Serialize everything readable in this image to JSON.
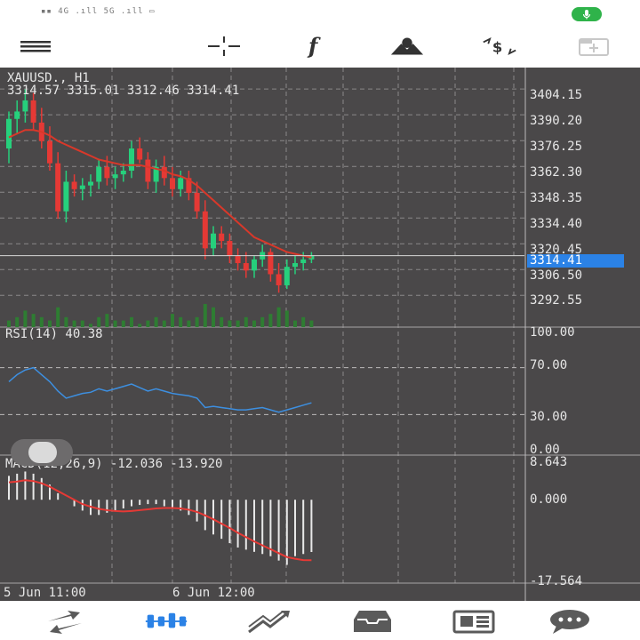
{
  "status_bar": {
    "signal_text": "▪▪ 4G .ıll 5G .ıll ▭"
  },
  "toolbar": {
    "icons": [
      "menu-icon",
      "crosshair-icon",
      "indicators-icon",
      "objects-icon",
      "trade-icon",
      "new-window-icon"
    ]
  },
  "chart": {
    "symbol_line": "XAUUSD., H1",
    "ohlc_line": "3314.57 3315.01 3312.46 3314.41",
    "current_price": "3314.41",
    "price_axis": [
      "3404.15",
      "3390.20",
      "3376.25",
      "3362.30",
      "3348.35",
      "3334.40",
      "3320.45",
      "3306.50",
      "3292.55"
    ],
    "time_axis": [
      "5 Jun 11:00",
      "6 Jun 12:00"
    ],
    "rsi": {
      "label": "RSI(14) 40.38",
      "levels": [
        "100.00",
        "70.00",
        "30.00",
        "0.00"
      ]
    },
    "macd": {
      "label": "MACD(12,26,9) -12.036 -13.920",
      "levels": [
        "8.643",
        "0.000",
        "-17.564"
      ]
    }
  },
  "chart_data": {
    "type": "line",
    "title": "XAUUSD., H1",
    "xlabel": "",
    "ylabel": "",
    "price_ylim": [
      3285,
      3410
    ],
    "candles": [
      {
        "o": 3372,
        "h": 3392,
        "l": 3364,
        "c": 3388
      },
      {
        "o": 3388,
        "h": 3398,
        "l": 3380,
        "c": 3392
      },
      {
        "o": 3392,
        "h": 3404,
        "l": 3386,
        "c": 3398
      },
      {
        "o": 3398,
        "h": 3402,
        "l": 3382,
        "c": 3386
      },
      {
        "o": 3386,
        "h": 3394,
        "l": 3372,
        "c": 3376
      },
      {
        "o": 3376,
        "h": 3384,
        "l": 3360,
        "c": 3364
      },
      {
        "o": 3364,
        "h": 3370,
        "l": 3334,
        "c": 3338
      },
      {
        "o": 3338,
        "h": 3360,
        "l": 3332,
        "c": 3354
      },
      {
        "o": 3354,
        "h": 3358,
        "l": 3346,
        "c": 3350
      },
      {
        "o": 3350,
        "h": 3356,
        "l": 3344,
        "c": 3352
      },
      {
        "o": 3352,
        "h": 3358,
        "l": 3346,
        "c": 3354
      },
      {
        "o": 3354,
        "h": 3366,
        "l": 3350,
        "c": 3362
      },
      {
        "o": 3362,
        "h": 3368,
        "l": 3352,
        "c": 3356
      },
      {
        "o": 3356,
        "h": 3362,
        "l": 3350,
        "c": 3358
      },
      {
        "o": 3358,
        "h": 3364,
        "l": 3354,
        "c": 3360
      },
      {
        "o": 3360,
        "h": 3376,
        "l": 3356,
        "c": 3372
      },
      {
        "o": 3372,
        "h": 3378,
        "l": 3364,
        "c": 3366
      },
      {
        "o": 3366,
        "h": 3370,
        "l": 3350,
        "c": 3354
      },
      {
        "o": 3354,
        "h": 3366,
        "l": 3348,
        "c": 3362
      },
      {
        "o": 3362,
        "h": 3368,
        "l": 3352,
        "c": 3356
      },
      {
        "o": 3356,
        "h": 3362,
        "l": 3346,
        "c": 3350
      },
      {
        "o": 3350,
        "h": 3360,
        "l": 3346,
        "c": 3356
      },
      {
        "o": 3356,
        "h": 3360,
        "l": 3344,
        "c": 3348
      },
      {
        "o": 3348,
        "h": 3354,
        "l": 3334,
        "c": 3338
      },
      {
        "o": 3338,
        "h": 3344,
        "l": 3312,
        "c": 3318
      },
      {
        "o": 3318,
        "h": 3330,
        "l": 3314,
        "c": 3326
      },
      {
        "o": 3326,
        "h": 3330,
        "l": 3318,
        "c": 3322
      },
      {
        "o": 3322,
        "h": 3326,
        "l": 3310,
        "c": 3314
      },
      {
        "o": 3314,
        "h": 3318,
        "l": 3306,
        "c": 3310
      },
      {
        "o": 3310,
        "h": 3316,
        "l": 3302,
        "c": 3306
      },
      {
        "o": 3306,
        "h": 3314,
        "l": 3302,
        "c": 3312
      },
      {
        "o": 3312,
        "h": 3320,
        "l": 3308,
        "c": 3316
      },
      {
        "o": 3316,
        "h": 3318,
        "l": 3300,
        "c": 3304
      },
      {
        "o": 3304,
        "h": 3310,
        "l": 3294,
        "c": 3298
      },
      {
        "o": 3298,
        "h": 3312,
        "l": 3296,
        "c": 3308
      },
      {
        "o": 3308,
        "h": 3314,
        "l": 3304,
        "c": 3310
      },
      {
        "o": 3310,
        "h": 3316,
        "l": 3306,
        "c": 3312
      },
      {
        "o": 3312,
        "h": 3316,
        "l": 3310,
        "c": 3314
      }
    ],
    "ma": [
      3378,
      3380,
      3382,
      3382,
      3381,
      3379,
      3376,
      3374,
      3372,
      3370,
      3368,
      3366,
      3365,
      3364,
      3363,
      3363,
      3363,
      3362,
      3361,
      3360,
      3358,
      3357,
      3355,
      3352,
      3348,
      3344,
      3340,
      3336,
      3332,
      3328,
      3324,
      3322,
      3320,
      3318,
      3316,
      3315,
      3314,
      3313
    ],
    "volume": [
      2,
      3,
      5,
      4,
      3,
      2,
      6,
      3,
      2,
      2,
      1,
      3,
      4,
      2,
      2,
      3,
      1,
      2,
      3,
      2,
      4,
      3,
      2,
      3,
      7,
      6,
      3,
      2,
      2,
      3,
      2,
      3,
      4,
      6,
      5,
      2,
      3,
      2
    ],
    "rsi_ylim": [
      0,
      100
    ],
    "rsi": [
      58,
      64,
      68,
      70,
      64,
      58,
      50,
      44,
      46,
      48,
      49,
      52,
      50,
      52,
      54,
      56,
      53,
      50,
      52,
      50,
      48,
      47,
      46,
      44,
      36,
      37,
      36,
      35,
      34,
      34,
      35,
      36,
      34,
      32,
      34,
      36,
      38,
      40
    ],
    "macd_ylim": [
      -17.564,
      8.643
    ],
    "macd_hist": [
      5.5,
      6.0,
      6.5,
      6.0,
      5.0,
      3.5,
      1.5,
      0,
      -1.5,
      -2.5,
      -3.5,
      -3.5,
      -3,
      -2.5,
      -2,
      -1.5,
      -1.2,
      -1,
      -1,
      -1.5,
      -2,
      -2.5,
      -3.5,
      -5,
      -7,
      -8,
      -9,
      -10,
      -11,
      -11.5,
      -12,
      -12.5,
      -13,
      -14,
      -15,
      -13,
      -12.5,
      -12.036
    ],
    "macd_signal": [
      4.0,
      4.2,
      4.5,
      4.3,
      3.8,
      3.0,
      2.0,
      1.0,
      0,
      -1.0,
      -1.6,
      -2.1,
      -2.4,
      -2.6,
      -2.7,
      -2.6,
      -2.4,
      -2.2,
      -2.0,
      -1.9,
      -1.9,
      -2.0,
      -2.3,
      -2.8,
      -3.6,
      -4.5,
      -5.5,
      -6.5,
      -7.6,
      -8.6,
      -9.6,
      -10.5,
      -11.4,
      -12.3,
      -13.2,
      -13.6,
      -13.9,
      -13.92
    ]
  },
  "bottom_nav": {
    "icons": [
      "quotes-icon",
      "chart-icon",
      "trade-icon",
      "history-icon",
      "news-icon",
      "messages-icon"
    ]
  }
}
